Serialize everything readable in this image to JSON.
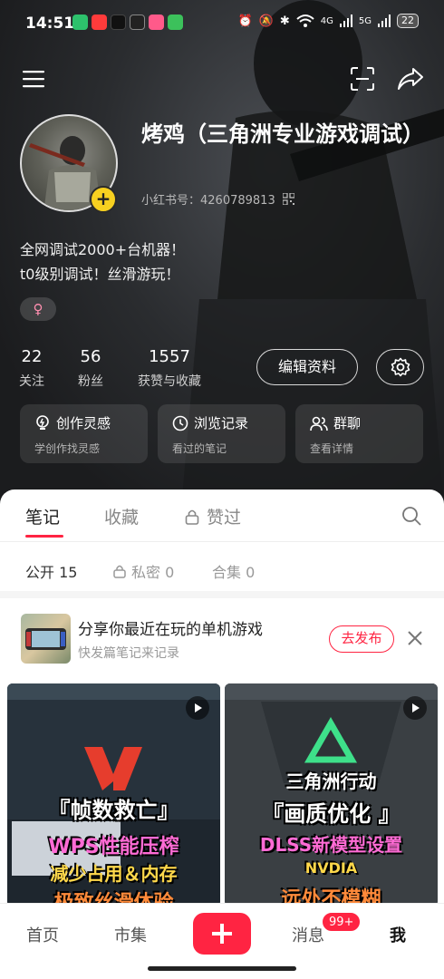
{
  "status_bar": {
    "time": "14:51",
    "battery": "22",
    "signal_labels": [
      "4G",
      "5G"
    ]
  },
  "profile": {
    "nickname": "烤鸡（三角洲专业游戏调试）",
    "red_id": "小红书号：4260789813",
    "bio_lines": [
      "全网调试2000+台机器！",
      "t0级别调试！丝滑游玩！"
    ],
    "gender_symbol": "♀",
    "avatar_badge": "+"
  },
  "stats": [
    {
      "num": "22",
      "label": "关注"
    },
    {
      "num": "56",
      "label": "粉丝"
    },
    {
      "num": "1557",
      "label": "获赞与收藏"
    }
  ],
  "buttons": {
    "edit_profile": "编辑资料"
  },
  "quick_cards": [
    {
      "title": "创作灵感",
      "sub": "学创作找灵感",
      "icon": "bulb-icon"
    },
    {
      "title": "浏览记录",
      "sub": "看过的笔记",
      "icon": "clock-icon"
    },
    {
      "title": "群聊",
      "sub": "查看详情",
      "icon": "group-icon"
    }
  ],
  "tabs": [
    "笔记",
    "收藏",
    "赞过"
  ],
  "sub_filters": [
    {
      "label": "公开 15"
    },
    {
      "label": "私密 0"
    },
    {
      "label": "合集 0"
    }
  ],
  "share_card": {
    "title": "分享你最近在玩的单机游戏",
    "sub": "快发篇笔记来记录",
    "button": "去发布"
  },
  "notes": [
    {
      "brand": "W",
      "title": "『帧数救亡』",
      "line1": "WPS性能压榨",
      "line2": "减少占用＆内存",
      "line3": "极致丝滑体验"
    },
    {
      "brand": "三角洲行动",
      "title": "『画质优化 』",
      "line1": "DLSS新模型设置",
      "line2": "NVDIA",
      "line3": "远处不模糊"
    }
  ],
  "bottom_nav": {
    "home": "首页",
    "market": "市集",
    "messages": "消息",
    "messages_badge": "99+",
    "me": "我"
  },
  "colors": {
    "accent": "#ff2442",
    "badge_yellow": "#f7d020"
  }
}
